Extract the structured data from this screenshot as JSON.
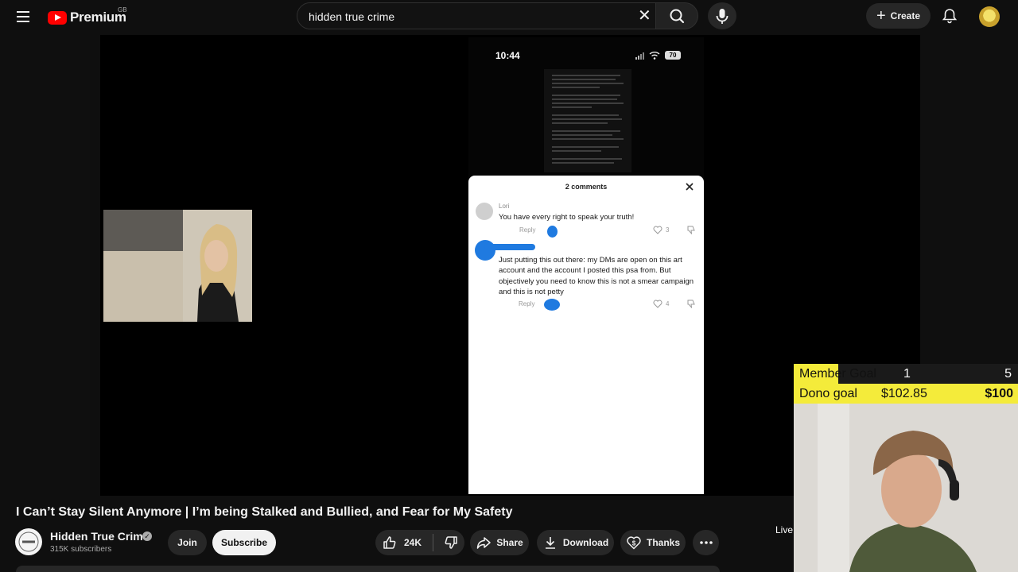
{
  "masthead": {
    "logo_text": "Premium",
    "region": "GB",
    "search_value": "hidden true crime",
    "create_label": "Create"
  },
  "video": {
    "phone": {
      "time": "10:44",
      "battery": "70",
      "comments_title": "2 comments",
      "comments": [
        {
          "user": "Lori",
          "text": "You have every right to speak your truth!",
          "reply": "Reply",
          "likes": "3"
        },
        {
          "user": "",
          "text": "Just putting this out there: my DMs are open on this art account and the account I posted this psa from. But objectively you need to know this is not a smear campaign and this is not petty",
          "reply": "Reply",
          "likes": "4"
        }
      ]
    },
    "overlay": {
      "member_goal_label": "Member Goal",
      "member_goal_current": "1",
      "member_goal_target": "5",
      "member_goal_progress": 0.2,
      "dono_goal_label": "Dono goal",
      "dono_goal_current": "$102.85",
      "dono_goal_target": "$100",
      "live_label": "Live"
    }
  },
  "info": {
    "title": "I Can’t Stay Silent Anymore | I’m being Stalked and Bullied, and Fear for My Safety",
    "channel_name": "Hidden True Crime",
    "subscribers": "315K subscribers",
    "join_label": "Join",
    "subscribe_label": "Subscribe",
    "like_count": "24K",
    "share_label": "Share",
    "download_label": "Download",
    "thanks_label": "Thanks"
  },
  "icons": {
    "menu": "menu-icon",
    "search": "search-icon",
    "clear": "close-icon",
    "mic": "mic-icon",
    "bell": "bell-icon",
    "like": "thumbs-up-icon",
    "dislike": "thumbs-down-icon",
    "share": "share-arrow-icon",
    "download": "download-icon",
    "thanks": "heart-dollar-icon",
    "more": "more-horiz-icon"
  },
  "colors": {
    "brand_red": "#ff0000",
    "goal_yellow": "#f4eb3a",
    "annotation_blue": "#1f7ae0",
    "background": "#0f0f0f"
  }
}
